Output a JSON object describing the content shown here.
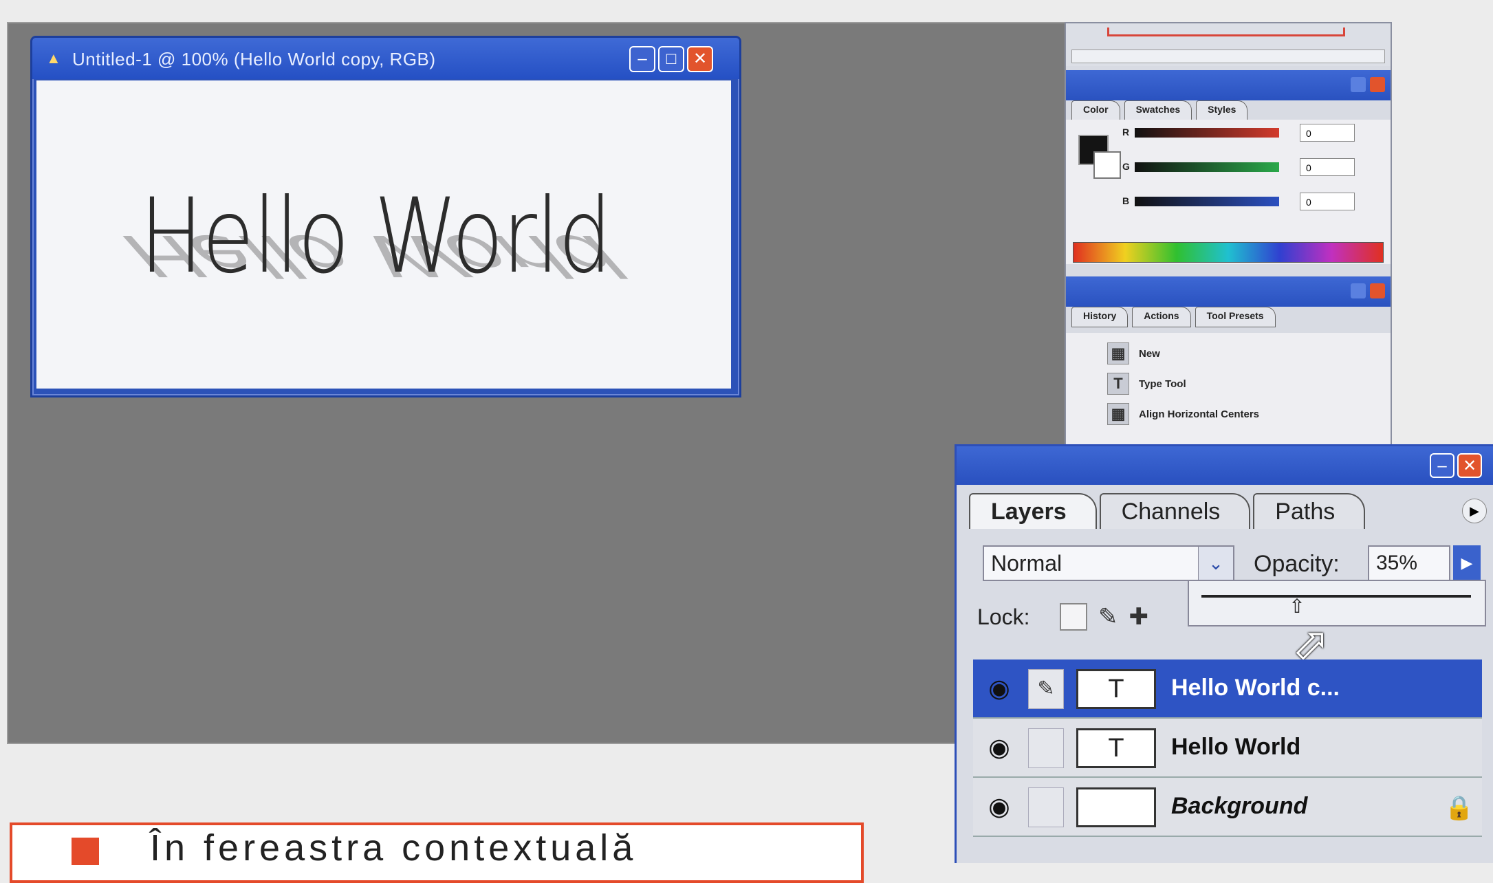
{
  "document": {
    "title": "Untitled-1 @ 100% (Hello World copy, RGB)",
    "canvas_text": "Hello World",
    "reflection_text": "Hello World"
  },
  "color_palette": {
    "tabs": [
      "Color",
      "Swatches",
      "Styles"
    ],
    "channels": [
      {
        "label": "R",
        "value": "0",
        "color": "#d23a2c"
      },
      {
        "label": "G",
        "value": "0",
        "color": "#2aa84a"
      },
      {
        "label": "B",
        "value": "0",
        "color": "#2b4fc0"
      }
    ]
  },
  "history_palette": {
    "tabs": [
      "History",
      "Actions",
      "Tool Presets"
    ],
    "items": [
      {
        "icon": "new-document-icon",
        "label": "New"
      },
      {
        "icon": "type-tool-icon",
        "label": "Type Tool"
      },
      {
        "icon": "align-icon",
        "label": "Align Horizontal Centers"
      }
    ]
  },
  "layers_panel": {
    "tabs": [
      "Layers",
      "Channels",
      "Paths"
    ],
    "blend_mode": "Normal",
    "opacity_label": "Opacity:",
    "opacity_value": "35%",
    "opacity_level": 0.35,
    "lock_label": "Lock:",
    "layers": [
      {
        "name": "Hello World c...",
        "selected": true,
        "type_icon": "T"
      },
      {
        "name": "Hello World",
        "selected": false,
        "type_icon": "T"
      },
      {
        "name": "Background",
        "selected": false,
        "type_icon": ""
      }
    ]
  },
  "caption": {
    "text": "În fereastra contextuală"
  },
  "colors": {
    "titlebar_blue": "#2c52b8",
    "selection_blue": "#2e54c4",
    "close_red": "#e2542c",
    "caption_border": "#e44a2a"
  }
}
